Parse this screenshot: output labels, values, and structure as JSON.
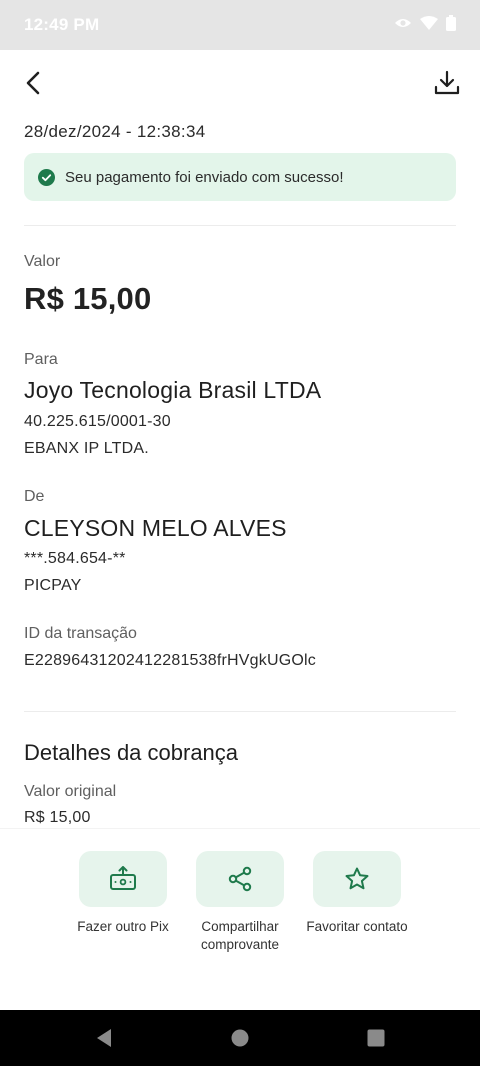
{
  "status_bar": {
    "time": "12:49 PM"
  },
  "transaction": {
    "datetime": "28/dez/2024 - 12:38:34",
    "success_message": "Seu pagamento foi enviado com sucesso!",
    "valor_label": "Valor",
    "valor": "R$ 15,00",
    "para_label": "Para",
    "para_name": "Joyo Tecnologia Brasil LTDA",
    "para_doc": "40.225.615/0001-30",
    "para_institution": "EBANX IP LTDA.",
    "de_label": "De",
    "de_name": "CLEYSON MELO ALVES",
    "de_doc": "***.584.654-**",
    "de_institution": "PICPAY",
    "id_label": "ID da transação",
    "id_value": "E22896431202412281538frHVgkUGOlc"
  },
  "details": {
    "title": "Detalhes da cobrança",
    "original_label": "Valor original",
    "original_value": "R$ 15,00"
  },
  "actions": [
    {
      "label": "Fazer outro Pix",
      "icon": "pix-transfer-icon"
    },
    {
      "label": "Compartilhar comprovante",
      "icon": "share-icon"
    },
    {
      "label": "Favoritar contato",
      "icon": "star-icon"
    }
  ],
  "colors": {
    "accent": "#1f7a4c",
    "success_bg": "#e3f5ea",
    "tile_bg": "#e6f4ec"
  }
}
